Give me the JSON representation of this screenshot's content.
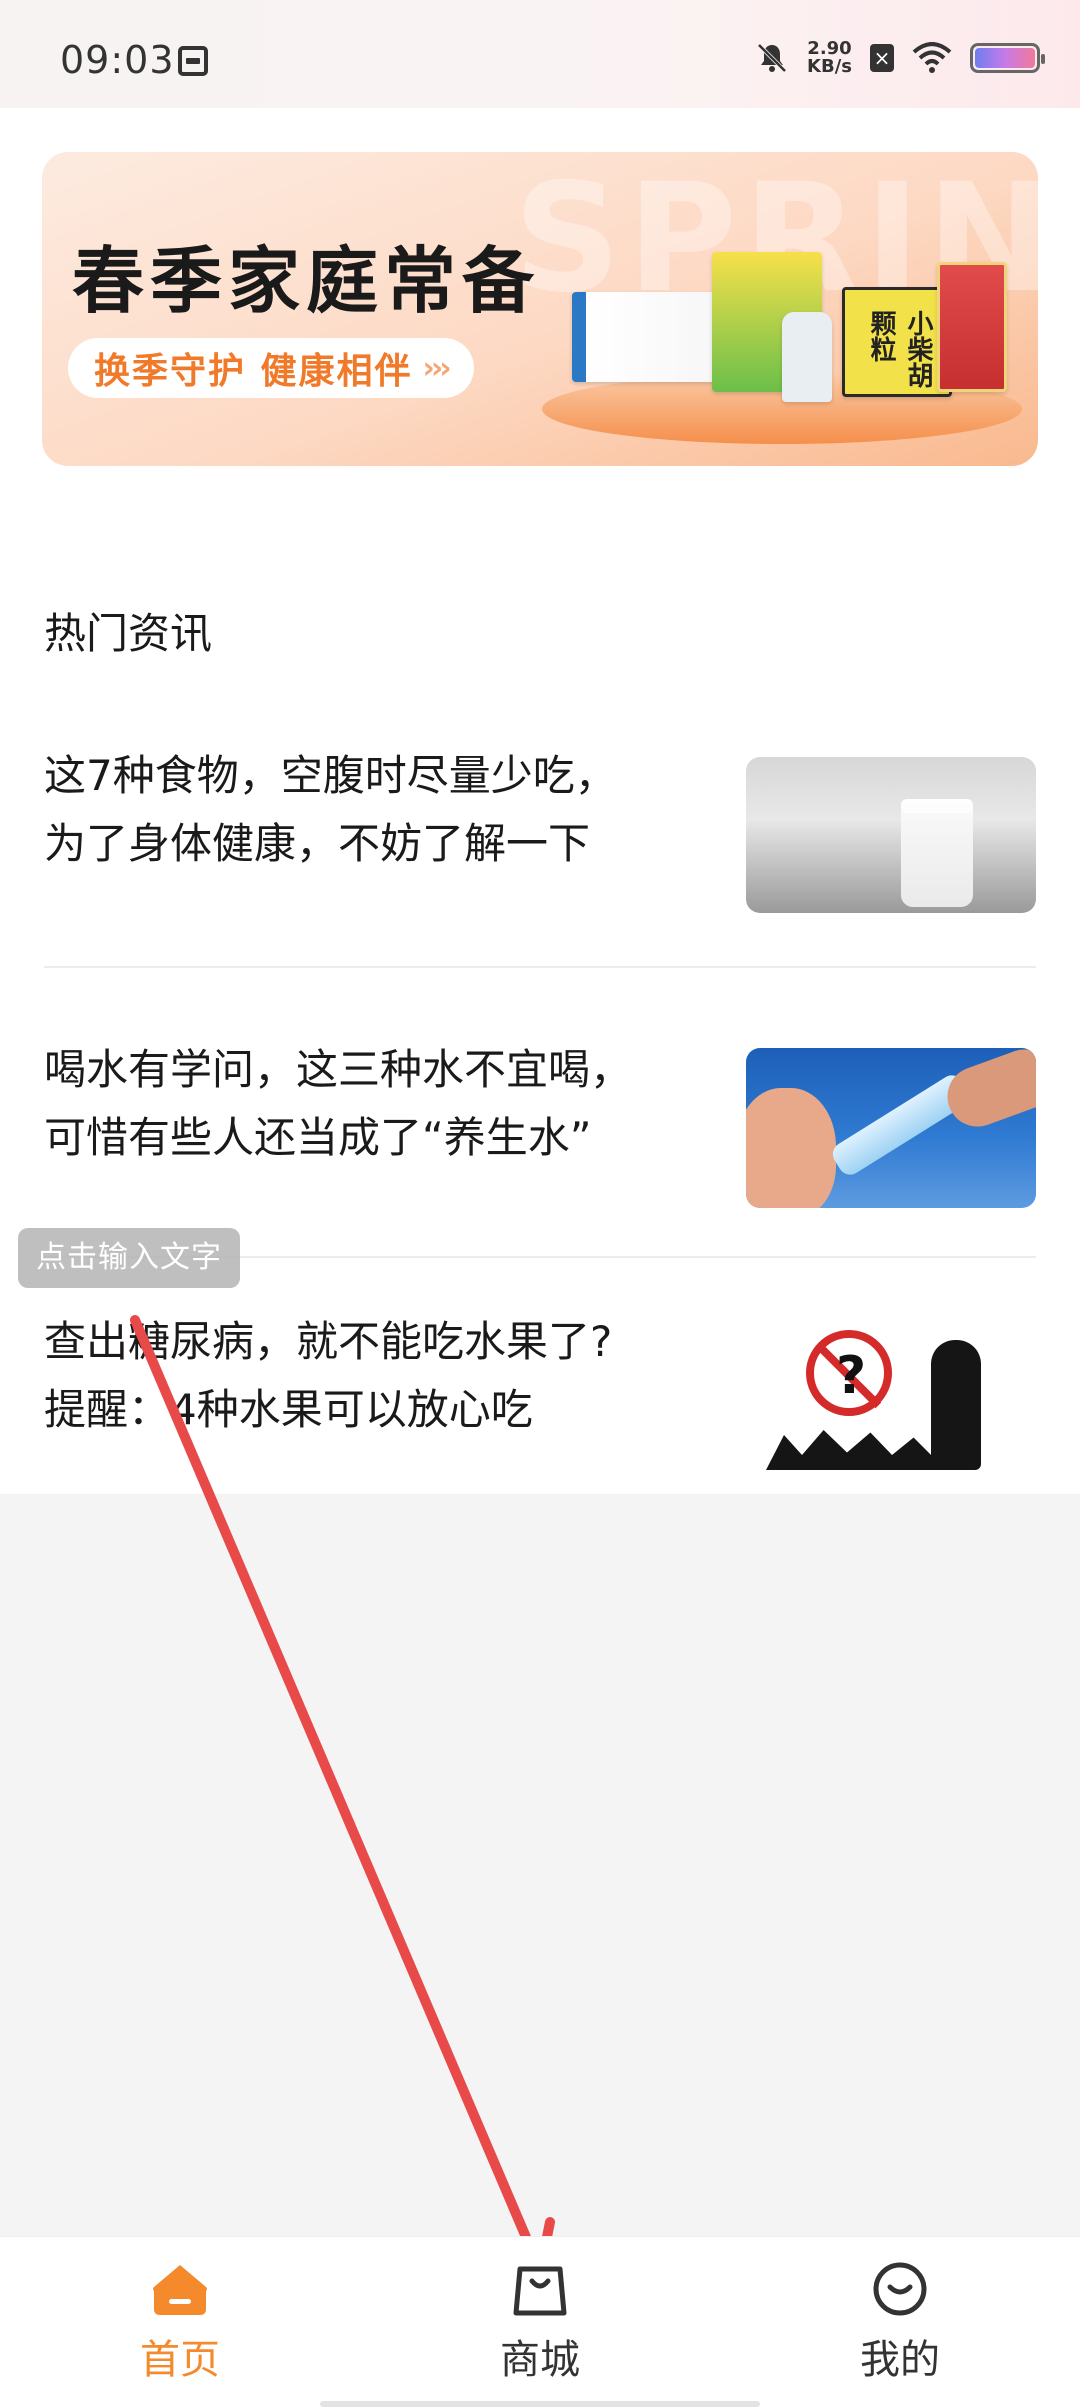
{
  "status_bar": {
    "time": "09:03",
    "net_speed_value": "2.90",
    "net_speed_unit": "KB/s",
    "x_badge": "×",
    "icons": [
      "clipboard-icon",
      "bell-off-icon",
      "wifi-icon",
      "battery-icon"
    ]
  },
  "banner": {
    "title": "春季家庭常备",
    "pill_text": "换季守护 健康相伴",
    "pill_arrows": "›››",
    "watermark": "SPRIN",
    "product_label": "小柴胡颗粒"
  },
  "hot_news": {
    "section_title": "热门资讯",
    "items": [
      {
        "line1": "这7种食物，空腹时尽量少吃，",
        "line2": "为了身体健康，不妨了解一下",
        "image": "milk-glass-photo"
      },
      {
        "line1": "喝水有学问，这三种水不宜喝，",
        "line2": "可惜有些人还当成了“养生水”",
        "image": "drinking-water-photo"
      },
      {
        "line1": "查出糖尿病，就不能吃水果了?",
        "line2": "提醒：4种水果可以放心吃",
        "image": "diabetes-fruit-illustration"
      }
    ]
  },
  "overlay": {
    "tooltip_text": "点击输入文字",
    "arrow_color": "#e84a4a"
  },
  "bottom_nav": {
    "tabs": [
      {
        "label": "首页",
        "icon": "home-icon",
        "active": true
      },
      {
        "label": "商城",
        "icon": "shopping-bag-icon",
        "active": false
      },
      {
        "label": "我的",
        "icon": "profile-smile-icon",
        "active": false
      }
    ],
    "active_color": "#f48a2c"
  }
}
